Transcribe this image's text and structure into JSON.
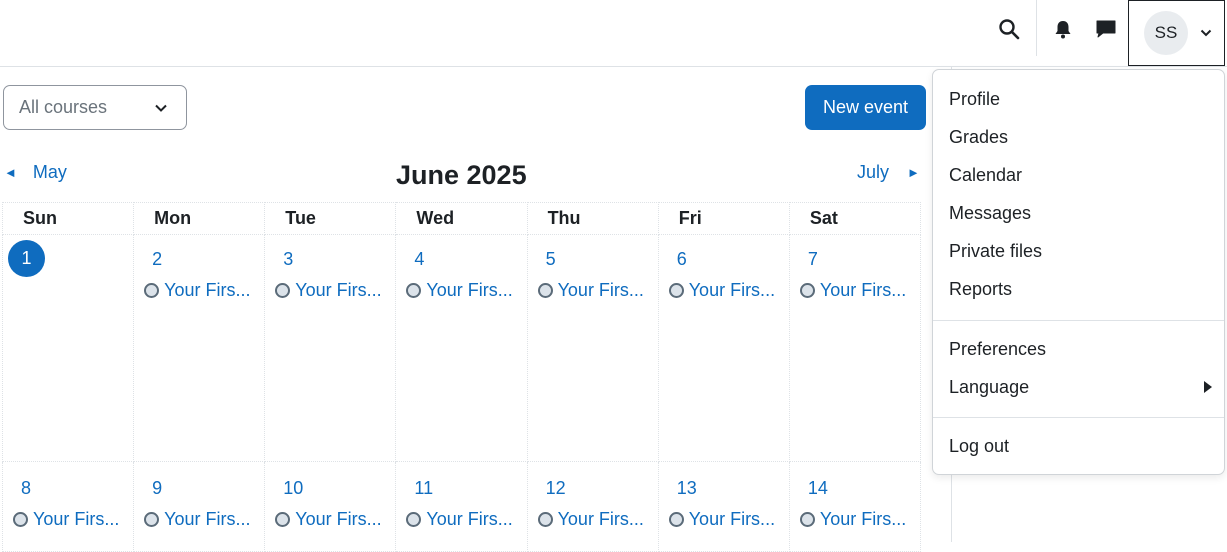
{
  "navbar": {
    "icons": [
      "search-icon",
      "bell-icon",
      "message-icon"
    ],
    "user_initials": "SS"
  },
  "controls": {
    "course_filter": "All courses",
    "new_event_label": "New event"
  },
  "calendar": {
    "prev_month": "May",
    "next_month": "July",
    "title": "June 2025",
    "weekdays": [
      "Sun",
      "Mon",
      "Tue",
      "Wed",
      "Thu",
      "Fri",
      "Sat"
    ],
    "weeks": [
      {
        "days": [
          {
            "num": "1",
            "today": true,
            "event": ""
          },
          {
            "num": "2",
            "event": "Your Firs..."
          },
          {
            "num": "3",
            "event": "Your Firs..."
          },
          {
            "num": "4",
            "event": "Your Firs..."
          },
          {
            "num": "5",
            "event": "Your Firs..."
          },
          {
            "num": "6",
            "event": "Your Firs..."
          },
          {
            "num": "7",
            "event": "Your Firs..."
          }
        ]
      },
      {
        "days": [
          {
            "num": "8",
            "event": "Your Firs..."
          },
          {
            "num": "9",
            "event": "Your Firs..."
          },
          {
            "num": "10",
            "event": "Your Firs..."
          },
          {
            "num": "11",
            "event": "Your Firs..."
          },
          {
            "num": "12",
            "event": "Your Firs..."
          },
          {
            "num": "13",
            "event": "Your Firs..."
          },
          {
            "num": "14",
            "event": "Your Firs..."
          }
        ]
      }
    ]
  },
  "user_menu": {
    "items": [
      "Profile",
      "Grades",
      "Calendar",
      "Messages",
      "Private files",
      "Reports"
    ],
    "pref_items": [
      "Preferences",
      "Language"
    ],
    "logout": "Log out"
  },
  "colors": {
    "primary": "#0f6cbf",
    "text": "#1d2125",
    "border": "#dee2e6"
  }
}
